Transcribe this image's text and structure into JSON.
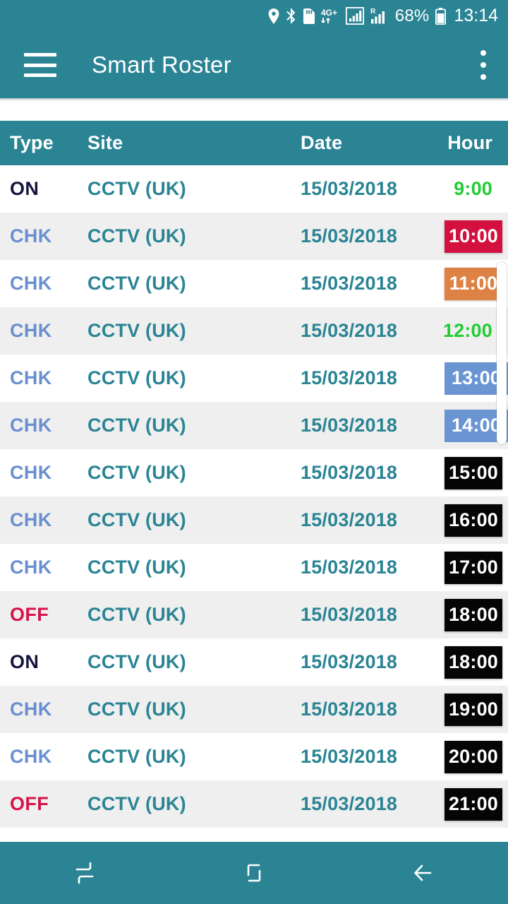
{
  "statusbar": {
    "icons": [
      "location-icon",
      "bluetooth-icon",
      "sd-card-icon",
      "network-4gplus-icon",
      "signal-bars-icon",
      "roaming-signal-icon"
    ],
    "network_label": "4G+",
    "roaming_label": "R",
    "battery_percent": "68%",
    "time": "13:14"
  },
  "toolbar": {
    "menu_icon": "hamburger-menu-icon",
    "title": "Smart Roster",
    "overflow_icon": "overflow-menu-icon"
  },
  "table": {
    "columns": [
      "Type",
      "Site",
      "Date",
      "Hour"
    ],
    "rows": [
      {
        "type": "ON",
        "site": "CCTV (UK)",
        "date": "15/03/2018",
        "hour": "9:00",
        "hour_style": "text-green"
      },
      {
        "type": "CHK",
        "site": "CCTV (UK)",
        "date": "15/03/2018",
        "hour": "10:00",
        "hour_style": "badge-red"
      },
      {
        "type": "CHK",
        "site": "CCTV (UK)",
        "date": "15/03/2018",
        "hour": "11:00",
        "hour_style": "badge-orange"
      },
      {
        "type": "CHK",
        "site": "CCTV (UK)",
        "date": "15/03/2018",
        "hour": "12:00",
        "hour_style": "text-green"
      },
      {
        "type": "CHK",
        "site": "CCTV (UK)",
        "date": "15/03/2018",
        "hour": "13:00",
        "hour_style": "badge-blue"
      },
      {
        "type": "CHK",
        "site": "CCTV (UK)",
        "date": "15/03/2018",
        "hour": "14:00",
        "hour_style": "badge-blue"
      },
      {
        "type": "CHK",
        "site": "CCTV (UK)",
        "date": "15/03/2018",
        "hour": "15:00",
        "hour_style": "badge-black"
      },
      {
        "type": "CHK",
        "site": "CCTV (UK)",
        "date": "15/03/2018",
        "hour": "16:00",
        "hour_style": "badge-black"
      },
      {
        "type": "CHK",
        "site": "CCTV (UK)",
        "date": "15/03/2018",
        "hour": "17:00",
        "hour_style": "badge-black"
      },
      {
        "type": "OFF",
        "site": "CCTV (UK)",
        "date": "15/03/2018",
        "hour": "18:00",
        "hour_style": "badge-black"
      },
      {
        "type": "ON",
        "site": "CCTV (UK)",
        "date": "15/03/2018",
        "hour": "18:00",
        "hour_style": "badge-black"
      },
      {
        "type": "CHK",
        "site": "CCTV (UK)",
        "date": "15/03/2018",
        "hour": "19:00",
        "hour_style": "badge-black"
      },
      {
        "type": "CHK",
        "site": "CCTV (UK)",
        "date": "15/03/2018",
        "hour": "20:00",
        "hour_style": "badge-black"
      },
      {
        "type": "OFF",
        "site": "CCTV (UK)",
        "date": "15/03/2018",
        "hour": "21:00",
        "hour_style": "badge-black"
      }
    ]
  },
  "navbar": {
    "recents_icon": "recents-icon",
    "home_icon": "home-icon",
    "back_icon": "back-arrow-icon"
  },
  "colors": {
    "teal": "#2a8494",
    "row_alt": "#efefef",
    "type_on": "#14143c",
    "type_chk": "#6a8fd0",
    "type_off": "#d6134a",
    "hour_green": "#22cc33",
    "badge_red": "#d4103f",
    "badge_orange": "#dd8244",
    "badge_blue": "#6a95d2",
    "badge_black": "#050505"
  }
}
